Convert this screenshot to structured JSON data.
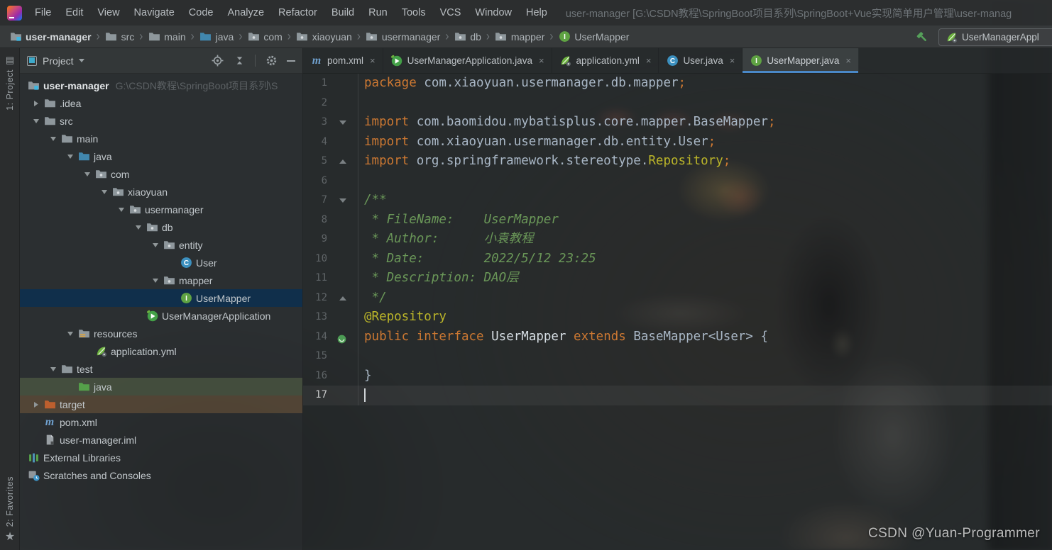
{
  "window": {
    "title": "user-manager [G:\\CSDN教程\\SpringBoot项目系列\\SpringBoot+Vue实现简单用户管理\\user-manag"
  },
  "menubar": {
    "items": [
      "File",
      "Edit",
      "View",
      "Navigate",
      "Code",
      "Analyze",
      "Refactor",
      "Build",
      "Run",
      "Tools",
      "VCS",
      "Window",
      "Help"
    ]
  },
  "navbar": {
    "breadcrumbs": [
      {
        "label": "user-manager",
        "icon": "project",
        "bold": true
      },
      {
        "label": "src",
        "icon": "folder"
      },
      {
        "label": "main",
        "icon": "folder"
      },
      {
        "label": "java",
        "icon": "folder-java"
      },
      {
        "label": "com",
        "icon": "folder-pkg"
      },
      {
        "label": "xiaoyuan",
        "icon": "folder-pkg"
      },
      {
        "label": "usermanager",
        "icon": "folder-pkg"
      },
      {
        "label": "db",
        "icon": "folder-pkg"
      },
      {
        "label": "mapper",
        "icon": "folder-pkg"
      },
      {
        "label": "UserMapper",
        "icon": "interface"
      }
    ],
    "separator": "›",
    "run_config": "UserManagerAppl"
  },
  "tool_stripes": {
    "top": "1: Project",
    "bottom": "2: Favorites",
    "star": "★"
  },
  "project": {
    "header": "Project",
    "tree": [
      {
        "label": "user-manager",
        "suffix": "G:\\CSDN教程\\SpringBoot项目系列\\S",
        "level": 0,
        "chevron": null,
        "icon": "project",
        "bold": true
      },
      {
        "label": ".idea",
        "level": 1,
        "chevron": "right",
        "icon": "folder"
      },
      {
        "label": "src",
        "level": 1,
        "chevron": "down",
        "icon": "folder"
      },
      {
        "label": "main",
        "level": 2,
        "chevron": "down",
        "icon": "folder"
      },
      {
        "label": "java",
        "level": 3,
        "chevron": "down",
        "icon": "folder-java"
      },
      {
        "label": "com",
        "level": 4,
        "chevron": "down",
        "icon": "folder-pkg"
      },
      {
        "label": "xiaoyuan",
        "level": 5,
        "chevron": "down",
        "icon": "folder-pkg"
      },
      {
        "label": "usermanager",
        "level": 6,
        "chevron": "down",
        "icon": "folder-pkg"
      },
      {
        "label": "db",
        "level": 7,
        "chevron": "down",
        "icon": "folder-pkg"
      },
      {
        "label": "entity",
        "level": 8,
        "chevron": "down",
        "icon": "folder-pkg"
      },
      {
        "label": "User",
        "level": 9,
        "chevron": null,
        "icon": "class"
      },
      {
        "label": "mapper",
        "level": 8,
        "chevron": "down",
        "icon": "folder-pkg"
      },
      {
        "label": "UserMapper",
        "level": 9,
        "chevron": null,
        "icon": "interface",
        "state": "selected"
      },
      {
        "label": "UserManagerApplication",
        "level": 7,
        "chevron": null,
        "icon": "springboot"
      },
      {
        "label": "resources",
        "level": 3,
        "chevron": "down",
        "icon": "folder-res"
      },
      {
        "label": "application.yml",
        "level": 4,
        "chevron": null,
        "icon": "springyml"
      },
      {
        "label": "test",
        "level": 2,
        "chevron": "down",
        "icon": "folder"
      },
      {
        "label": "java",
        "level": 3,
        "chevron": null,
        "icon": "folder-test",
        "state": "test"
      },
      {
        "label": "target",
        "level": 1,
        "chevron": "right",
        "icon": "folder-target",
        "state": "excluded"
      },
      {
        "label": "pom.xml",
        "level": 1,
        "chevron": null,
        "icon": "maven"
      },
      {
        "label": "user-manager.iml",
        "level": 1,
        "chevron": null,
        "icon": "iml"
      },
      {
        "label": "External Libraries",
        "level": 0,
        "chevron": null,
        "icon": "extlib"
      },
      {
        "label": "Scratches and Consoles",
        "level": 0,
        "chevron": null,
        "icon": "scratches"
      }
    ]
  },
  "editor": {
    "tabs": [
      {
        "label": "pom.xml",
        "icon": "maven",
        "active": false
      },
      {
        "label": "UserManagerApplication.java",
        "icon": "springboot",
        "active": false
      },
      {
        "label": "application.yml",
        "icon": "springyml",
        "active": false
      },
      {
        "label": "User.java",
        "icon": "class",
        "active": false
      },
      {
        "label": "UserMapper.java",
        "icon": "interface",
        "active": true
      }
    ],
    "tab_close_glyph": "×",
    "code": [
      {
        "n": 1,
        "tokens": [
          [
            "package",
            "k"
          ],
          [
            " com.xiaoyuan.usermanager.db.mapper",
            "d"
          ],
          [
            ";",
            "s"
          ]
        ]
      },
      {
        "n": 2,
        "tokens": []
      },
      {
        "n": 3,
        "fold": "open",
        "tokens": [
          [
            "import",
            "k"
          ],
          [
            " com.baomidou.mybatisplus.core.mapper.BaseMapper",
            "d"
          ],
          [
            ";",
            "s"
          ]
        ]
      },
      {
        "n": 4,
        "tokens": [
          [
            "import",
            "k"
          ],
          [
            " com.xiaoyuan.usermanager.db.entity.User",
            "d"
          ],
          [
            ";",
            "s"
          ]
        ]
      },
      {
        "n": 5,
        "fold": "close",
        "tokens": [
          [
            "import",
            "k"
          ],
          [
            " org.springframework.stereotype.",
            "d"
          ],
          [
            "Repository",
            "a"
          ],
          [
            ";",
            "s"
          ]
        ]
      },
      {
        "n": 6,
        "tokens": []
      },
      {
        "n": 7,
        "fold": "open",
        "tokens": [
          [
            "/**",
            "c"
          ]
        ]
      },
      {
        "n": 8,
        "tokens": [
          [
            " * FileName:    UserMapper",
            "c"
          ]
        ]
      },
      {
        "n": 9,
        "tokens": [
          [
            " * Author:      小袁教程",
            "c"
          ]
        ]
      },
      {
        "n": 10,
        "tokens": [
          [
            " * Date:        2022/5/12 23:25",
            "c"
          ]
        ]
      },
      {
        "n": 11,
        "tokens": [
          [
            " * Description: DAO层",
            "c"
          ]
        ]
      },
      {
        "n": 12,
        "fold": "close",
        "tokens": [
          [
            " */",
            "c"
          ]
        ]
      },
      {
        "n": 13,
        "tokens": [
          [
            "@Repository",
            "a"
          ]
        ]
      },
      {
        "n": 14,
        "gutter_icon": "bean",
        "tokens": [
          [
            "public",
            "k"
          ],
          [
            " ",
            "d"
          ],
          [
            "interface",
            "k"
          ],
          [
            " ",
            "d"
          ],
          [
            "UserMapper",
            "w"
          ],
          [
            " ",
            "d"
          ],
          [
            "extends",
            "k"
          ],
          [
            " BaseMapper<User> {",
            "d"
          ]
        ]
      },
      {
        "n": 15,
        "tokens": []
      },
      {
        "n": 16,
        "tokens": [
          [
            "}",
            "d"
          ]
        ]
      },
      {
        "n": 17,
        "current": true,
        "caret": true,
        "tokens": []
      }
    ]
  },
  "watermark": "CSDN @Yuan-Programmer",
  "colors": {
    "accent_underline": "#4A88C7",
    "selection_blue": "#0E304D",
    "keyword": "#CC7832",
    "annotation": "#BBB529",
    "comment": "#6A9758",
    "default_text": "#A9B7C6",
    "test_scope_green": "#5C6C4A",
    "excluded_brown": "#7D5F3C"
  }
}
